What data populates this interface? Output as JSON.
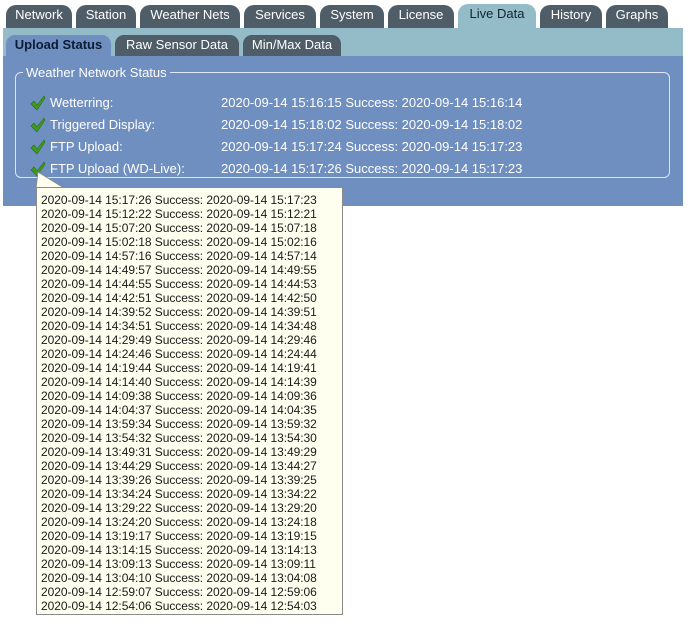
{
  "top_tabs": [
    {
      "label": "Network"
    },
    {
      "label": "Station"
    },
    {
      "label": "Weather Nets"
    },
    {
      "label": "Services"
    },
    {
      "label": "System"
    },
    {
      "label": "License"
    },
    {
      "label": "Live Data"
    },
    {
      "label": "History"
    },
    {
      "label": "Graphs"
    }
  ],
  "active_top_tab": "Live Data",
  "sub_tabs": [
    {
      "label": "Upload Status"
    },
    {
      "label": "Raw Sensor Data"
    },
    {
      "label": "Min/Max Data"
    }
  ],
  "active_sub_tab": "Upload Status",
  "status": {
    "legend": "Weather Network Status",
    "rows": [
      {
        "icon": "check-icon",
        "label": "Wetterring:",
        "value": "2020-09-14 15:16:15 Success: 2020-09-14 15:16:14"
      },
      {
        "icon": "check-icon",
        "label": "Triggered Display:",
        "value": "2020-09-14 15:18:02 Success: 2020-09-14 15:18:02"
      },
      {
        "icon": "check-icon",
        "label": "FTP Upload:",
        "value": "2020-09-14 15:17:24 Success: 2020-09-14 15:17:23"
      },
      {
        "icon": "check-icon",
        "label": "FTP Upload (WD-Live):",
        "value": "2020-09-14 15:17:26 Success: 2020-09-14 15:17:23"
      }
    ]
  },
  "tooltip": {
    "lines": [
      "2020-09-14 15:17:26 Success: 2020-09-14 15:17:23",
      "2020-09-14 15:12:22 Success: 2020-09-14 15:12:21",
      "2020-09-14 15:07:20 Success: 2020-09-14 15:07:18",
      "2020-09-14 15:02:18 Success: 2020-09-14 15:02:16",
      "2020-09-14 14:57:16 Success: 2020-09-14 14:57:14",
      "2020-09-14 14:49:57 Success: 2020-09-14 14:49:55",
      "2020-09-14 14:44:55 Success: 2020-09-14 14:44:53",
      "2020-09-14 14:42:51 Success: 2020-09-14 14:42:50",
      "2020-09-14 14:39:52 Success: 2020-09-14 14:39:51",
      "2020-09-14 14:34:51 Success: 2020-09-14 14:34:48",
      "2020-09-14 14:29:49 Success: 2020-09-14 14:29:46",
      "2020-09-14 14:24:46 Success: 2020-09-14 14:24:44",
      "2020-09-14 14:19:44 Success: 2020-09-14 14:19:41",
      "2020-09-14 14:14:40 Success: 2020-09-14 14:14:39",
      "2020-09-14 14:09:38 Success: 2020-09-14 14:09:36",
      "2020-09-14 14:04:37 Success: 2020-09-14 14:04:35",
      "2020-09-14 13:59:34 Success: 2020-09-14 13:59:32",
      "2020-09-14 13:54:32 Success: 2020-09-14 13:54:30",
      "2020-09-14 13:49:31 Success: 2020-09-14 13:49:29",
      "2020-09-14 13:44:29 Success: 2020-09-14 13:44:27",
      "2020-09-14 13:39:26 Success: 2020-09-14 13:39:25",
      "2020-09-14 13:34:24 Success: 2020-09-14 13:34:22",
      "2020-09-14 13:29:22 Success: 2020-09-14 13:29:20",
      "2020-09-14 13:24:20 Success: 2020-09-14 13:24:18",
      "2020-09-14 13:19:17 Success: 2020-09-14 13:19:15",
      "2020-09-14 13:14:15 Success: 2020-09-14 13:14:13",
      "2020-09-14 13:09:13 Success: 2020-09-14 13:09:11",
      "2020-09-14 13:04:10 Success: 2020-09-14 13:04:08",
      "2020-09-14 12:59:07 Success: 2020-09-14 12:59:06",
      "2020-09-14 12:54:06 Success: 2020-09-14 12:54:03"
    ]
  },
  "colors": {
    "tab_dark": "#4e5d67",
    "tab_active": "#93bcc8",
    "panel": "#6f8fc0",
    "check_green": "#3f9b1e",
    "tooltip_bg": "#fffff0"
  }
}
